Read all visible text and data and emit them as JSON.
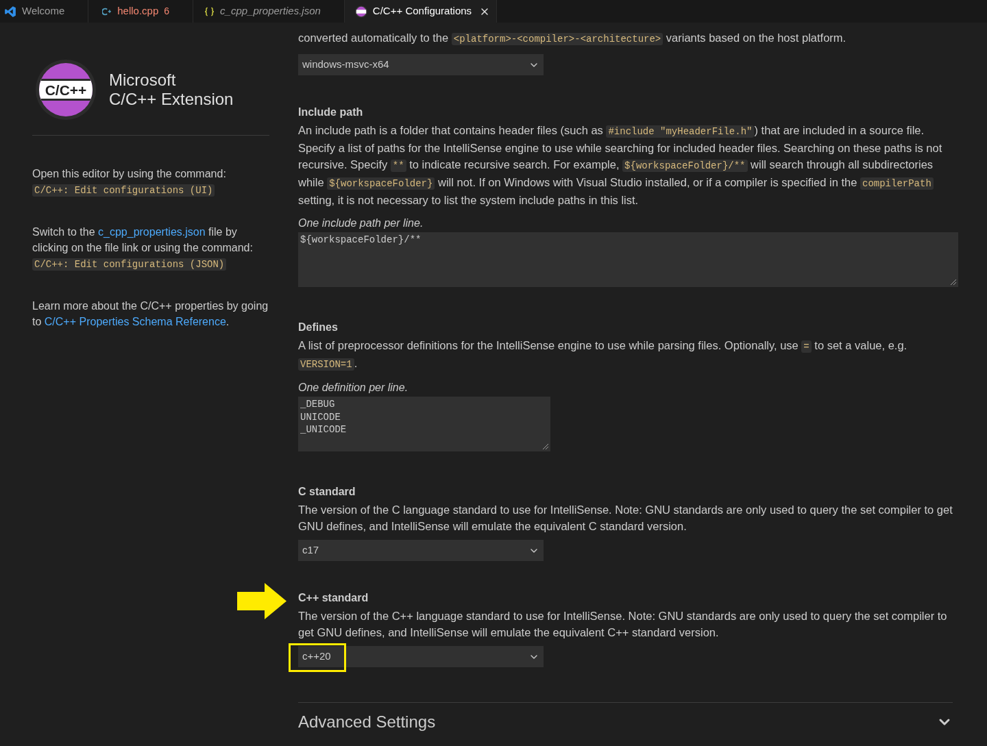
{
  "tabs": [
    {
      "kind": "welcome",
      "label": "Welcome",
      "preview": false,
      "selected": false
    },
    {
      "kind": "cpp",
      "label": "hello.cpp",
      "errors": "6",
      "preview": false,
      "selected": false
    },
    {
      "kind": "json",
      "label": "c_cpp_properties.json",
      "preview": true,
      "selected": false
    },
    {
      "kind": "extension",
      "label": "C/C++ Configurations",
      "preview": false,
      "selected": true
    }
  ],
  "sidebar": {
    "logo_text": "C/C++",
    "title": [
      "Microsoft",
      "C/C++ Extension"
    ],
    "paragraphs": [
      [
        {
          "kind": "text",
          "text": "Open this editor by using the command: "
        },
        {
          "kind": "code",
          "text": "C/C++: Edit configurations (UI)"
        }
      ],
      [
        {
          "kind": "text",
          "text": "Switch to the "
        },
        {
          "kind": "link",
          "text": "c_cpp_properties.json"
        },
        {
          "kind": "text",
          "text": " file by clicking on the file link or using the command: "
        },
        {
          "kind": "code",
          "text": "C/C++: Edit configurations (JSON)"
        }
      ],
      [
        {
          "kind": "text",
          "text": "Learn more about the C/C++ properties by going to "
        },
        {
          "kind": "link",
          "text": "C/C++ Properties Schema Reference"
        },
        {
          "kind": "text",
          "text": "."
        }
      ]
    ]
  },
  "settings": [
    {
      "description": [
        {
          "kind": "text",
          "text": "converted automatically to the "
        },
        {
          "kind": "code",
          "text": "<platform>-<compiler>-<architecture>"
        },
        {
          "kind": "text",
          "text": " variants based on the host platform."
        }
      ],
      "control": {
        "kind": "select",
        "value": "windows-msvc-x64"
      },
      "highlighted": false
    },
    {
      "title": "Include path",
      "description": [
        {
          "kind": "text",
          "text": "An include path is a folder that contains header files (such as "
        },
        {
          "kind": "code",
          "text": "#include \"myHeaderFile.h\""
        },
        {
          "kind": "text",
          "text": ") that are included in a source file. Specify a list of paths for the IntelliSense engine to use while searching for included header files. Searching on these paths is not recursive. Specify "
        },
        {
          "kind": "code",
          "text": "**"
        },
        {
          "kind": "text",
          "text": " to indicate recursive search. For example, "
        },
        {
          "kind": "code",
          "text": "${workspaceFolder}/**"
        },
        {
          "kind": "text",
          "text": " will search through all subdirectories while "
        },
        {
          "kind": "code",
          "text": "${workspaceFolder}"
        },
        {
          "kind": "text",
          "text": " will not. If on Windows with Visual Studio installed, or if a compiler is specified in the "
        },
        {
          "kind": "code",
          "text": "compilerPath"
        },
        {
          "kind": "text",
          "text": " setting, it is not necessary to list the system include paths in this list."
        }
      ],
      "hint": "One include path per line.",
      "control": {
        "kind": "wide-textarea",
        "lines": [
          "${workspaceFolder}/**"
        ]
      },
      "highlighted": false
    },
    {
      "title": "Defines",
      "description": [
        {
          "kind": "text",
          "text": "A list of preprocessor definitions for the IntelliSense engine to use while parsing files. Optionally, use "
        },
        {
          "kind": "code",
          "text": "="
        },
        {
          "kind": "text",
          "text": " to set a value, e.g. "
        },
        {
          "kind": "code",
          "text": "VERSION=1"
        },
        {
          "kind": "text",
          "text": "."
        }
      ],
      "hint": "One definition per line.",
      "control": {
        "kind": "textarea",
        "lines": [
          "_DEBUG",
          "UNICODE",
          "_UNICODE"
        ]
      },
      "highlighted": false
    },
    {
      "title": "C standard",
      "description": [
        {
          "kind": "text",
          "text": "The version of the C language standard to use for IntelliSense. Note: GNU standards are only used to query the set compiler to get GNU defines, and IntelliSense will emulate the equivalent C standard version."
        }
      ],
      "control": {
        "kind": "select",
        "value": "c17"
      },
      "highlighted": false
    },
    {
      "title": "C++ standard",
      "description": [
        {
          "kind": "text",
          "text": "The version of the C++ language standard to use for IntelliSense. Note: GNU standards are only used to query the set compiler to get GNU defines, and IntelliSense will emulate the equivalent C++ standard version."
        }
      ],
      "control": {
        "kind": "select",
        "value": "c++20"
      },
      "highlighted": true
    }
  ],
  "advanced": {
    "title": "Advanced Settings",
    "expanded": false
  }
}
